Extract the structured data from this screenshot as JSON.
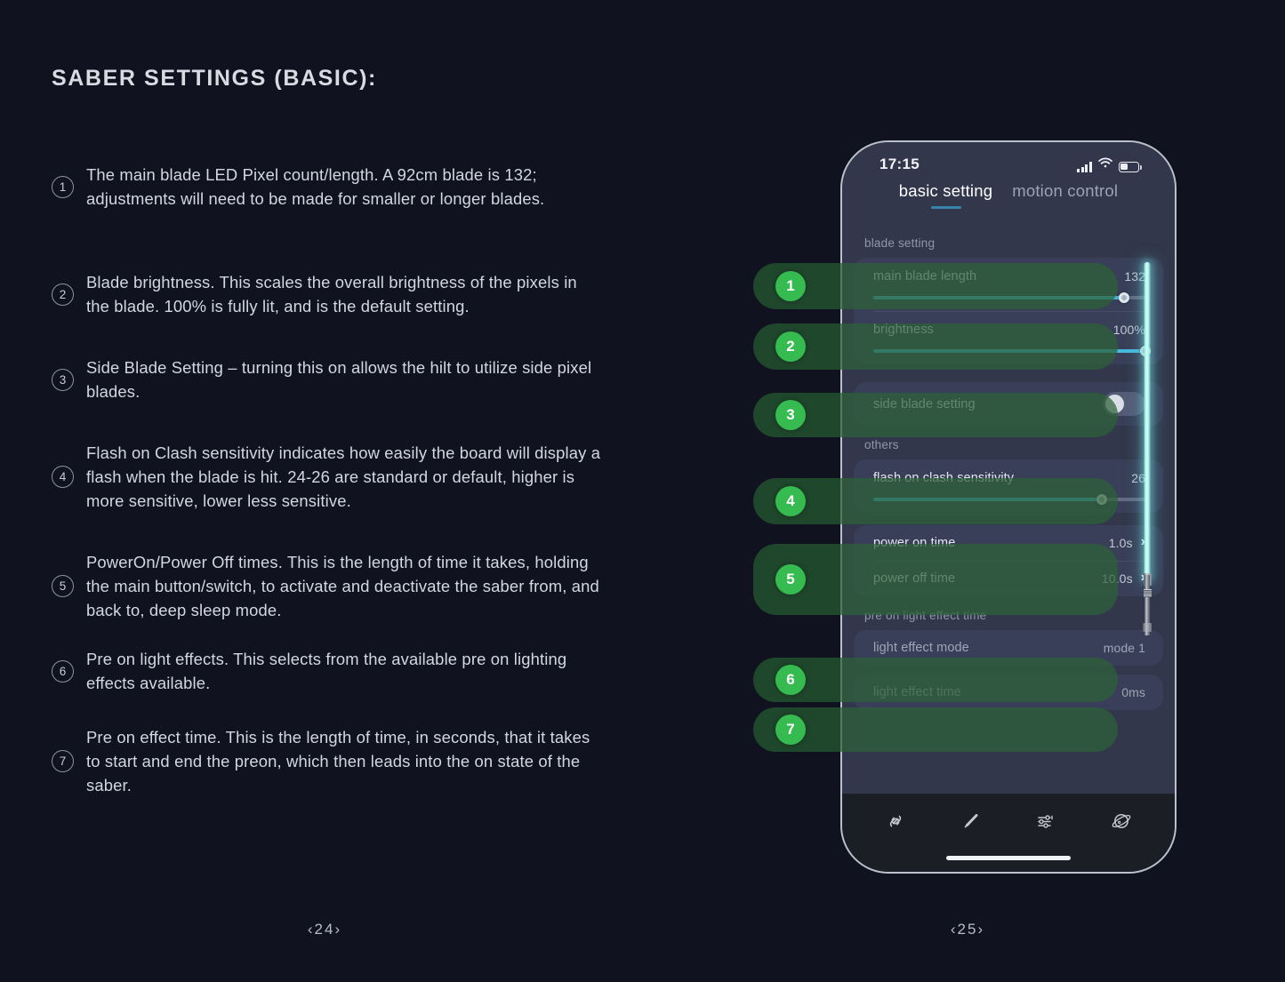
{
  "document": {
    "title": "SABER SETTINGS (BASIC):",
    "page_left": "‹24›",
    "page_right": "‹25›"
  },
  "notes": [
    {
      "num": "1",
      "text": "The main blade LED Pixel count/length. A 92cm blade is 132; adjustments will need to be made for smaller or longer  blades."
    },
    {
      "num": "2",
      "text": "Blade brightness. This scales the overall brightness of the pixels in the blade. 100% is fully lit, and is the default setting."
    },
    {
      "num": "3",
      "text": "Side Blade Setting – turning this on allows the hilt to utilize side pixel blades."
    },
    {
      "num": "4",
      "text": "Flash on Clash sensitivity indicates how easily the board will display a flash when the blade is hit. 24-26 are standard or default, higher is more sensitive, lower less sensitive."
    },
    {
      "num": "5",
      "text": "PowerOn/Power Off times. This is the length of time it takes, holding the main button/switch, to activate and deactivate the saber from, and back to, deep sleep mode."
    },
    {
      "num": "6",
      "text": "Pre on light effects. This selects from the available pre on lighting effects available."
    },
    {
      "num": "7",
      "text": "Pre on effect time. This is the length of time, in seconds, that it takes to start and end the preon, which then leads into the on state of the saber."
    }
  ],
  "phone": {
    "status": {
      "time": "17:15",
      "signal_icon": "cellular-signal-icon",
      "wifi_icon": "wifi-icon",
      "battery_icon": "battery-icon"
    },
    "tabs": [
      {
        "label": "basic setting",
        "active": true
      },
      {
        "label": "motion control",
        "active": false
      }
    ],
    "sections": [
      {
        "label": "blade setting",
        "rows": [
          {
            "label": "main blade length",
            "value": "132",
            "control": "slider",
            "percent": 92
          },
          {
            "label": "brightness",
            "value": "100%",
            "control": "slider",
            "percent": 100
          }
        ]
      },
      {
        "label": "",
        "rows": [
          {
            "label": "side blade setting",
            "value": "",
            "control": "toggle",
            "on": false
          }
        ]
      },
      {
        "label": "others",
        "rows": [
          {
            "label": "flash on clash sensitivity",
            "value": "26",
            "control": "slider",
            "percent": 84
          }
        ]
      },
      {
        "label": "",
        "rows": [
          {
            "label": "power on time",
            "value": "1.0s",
            "control": "chevron",
            "chevron": "›"
          },
          {
            "label": "power off time",
            "value": "10.0s",
            "control": "chevron",
            "chevron": "›"
          }
        ]
      },
      {
        "label": "pre on light effect time",
        "rows": [
          {
            "label": "light effect mode",
            "value": "mode 1",
            "control": "none",
            "dim": true
          },
          {
            "label": "light effect time",
            "value": "0ms",
            "control": "none",
            "dim": true
          }
        ]
      }
    ],
    "tabbar": [
      {
        "icon": "link-chain-icon"
      },
      {
        "icon": "saber-pen-icon"
      },
      {
        "icon": "sliders-settings-icon"
      },
      {
        "icon": "planet-icon"
      }
    ]
  },
  "callouts": [
    {
      "num": "1"
    },
    {
      "num": "2"
    },
    {
      "num": "3"
    },
    {
      "num": "4"
    },
    {
      "num": "5"
    },
    {
      "num": "6"
    },
    {
      "num": "7"
    }
  ],
  "colors": {
    "accent_blue": "#43b6dd",
    "callout_green": "#35bb4f",
    "blade_cyan": "#a8f0ea",
    "phone_bg": "#2b3045",
    "card_bg": "#323852",
    "page_bg": "#101220"
  }
}
